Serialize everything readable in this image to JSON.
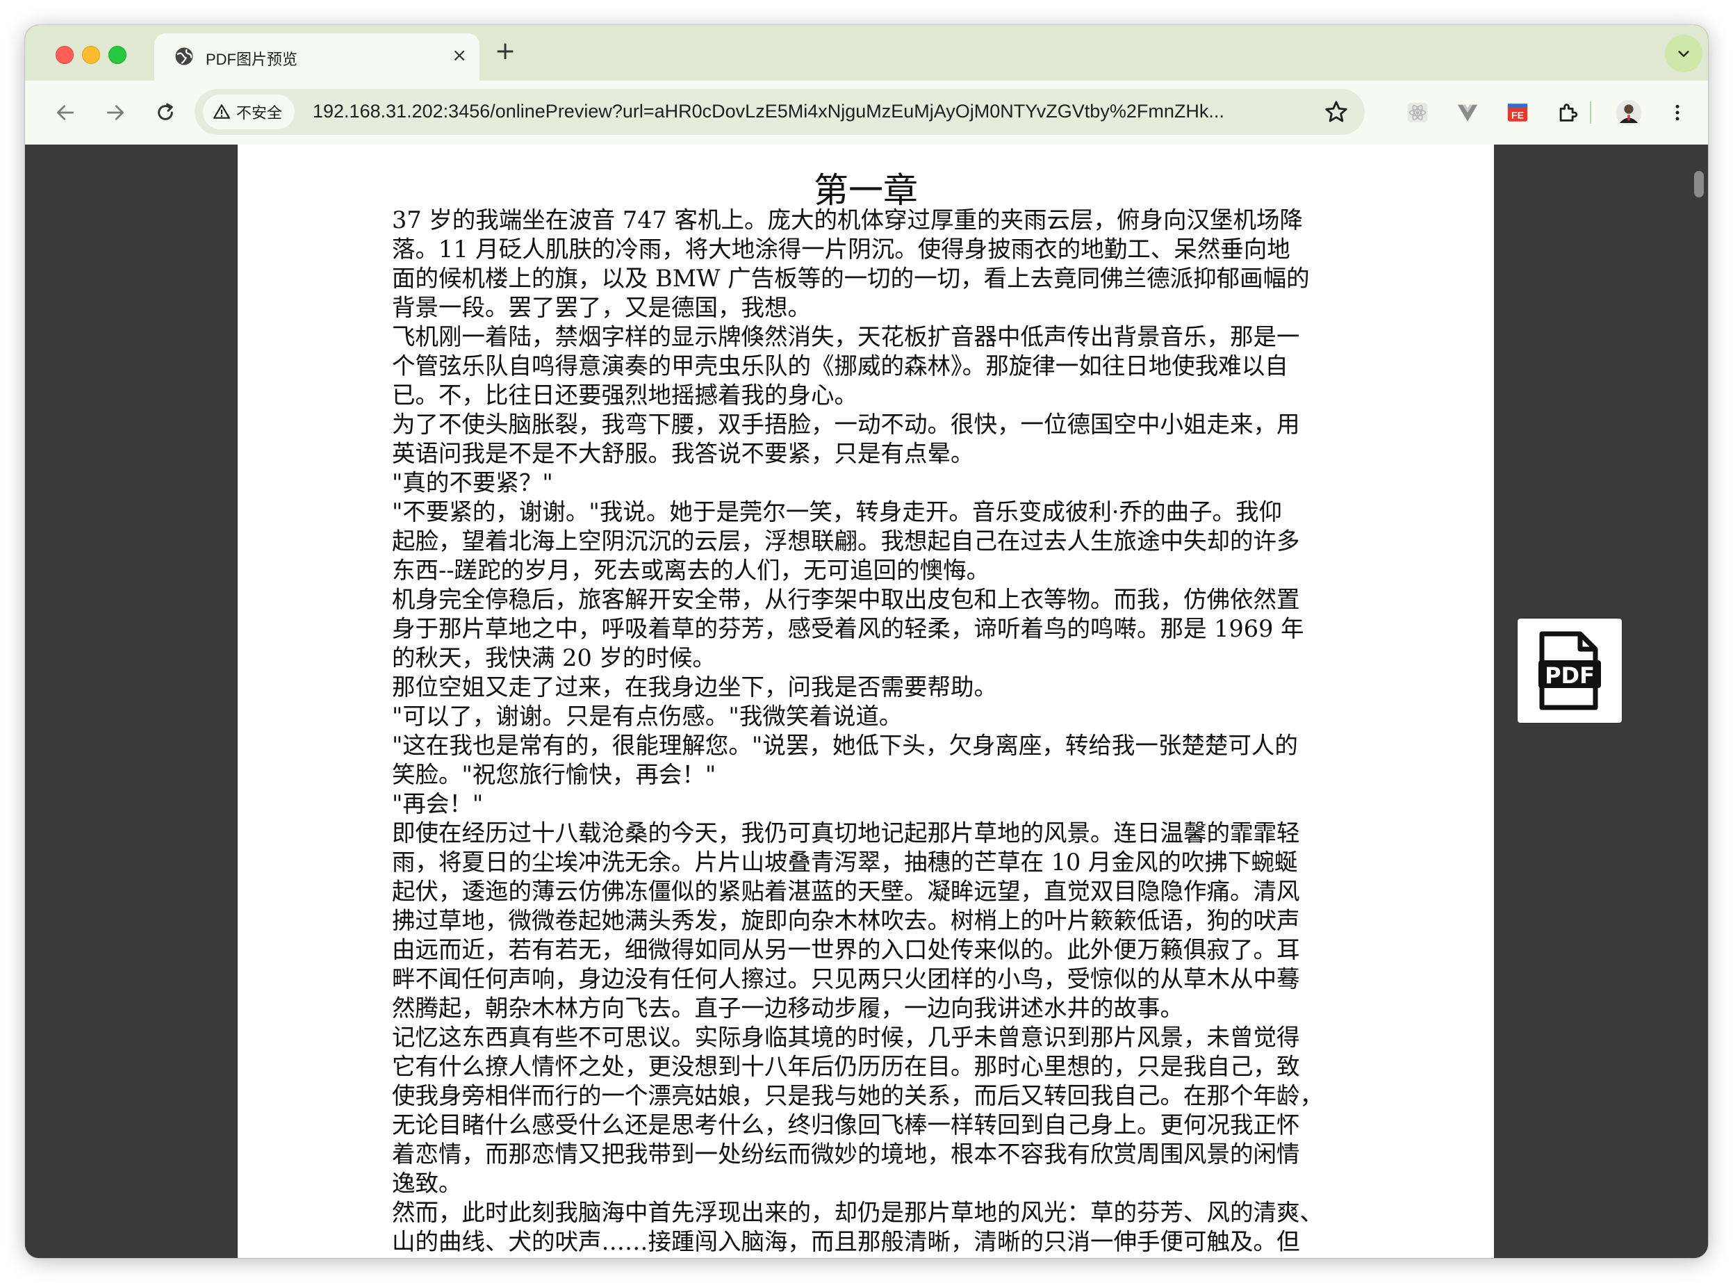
{
  "browser": {
    "tab": {
      "title": "PDF图片预览",
      "close_label": "×",
      "favicon": "globe-icon"
    },
    "new_tab_label": "+",
    "security_label": "不安全",
    "url": "192.168.31.202:3456/onlinePreview?url=aHR0cDovLzE5Mi4xNjguMzEuMjAyOjM0NTYvZGVtby%2FmnZHk...",
    "extensions": [
      "react-devtools-icon",
      "vue-devtools-icon",
      "fehelper-icon",
      "puzzle-icon"
    ],
    "fehelper_label": "FE"
  },
  "document": {
    "chapter_title": "第一章",
    "lines": [
      "37 岁的我端坐在波音 747 客机上。庞大的机体穿过厚重的夹雨云层，俯身向汉堡机场降",
      "落。11 月砭人肌肤的冷雨，将大地涂得一片阴沉。使得身披雨衣的地勤工、呆然垂向地",
      "面的候机楼上的旗，以及 BMW 广告板等的一切的一切，看上去竟同佛兰德派抑郁画幅的",
      "背景一段。罢了罢了，又是德国，我想。",
      "飞机刚一着陆，禁烟字样的显示牌倏然消失，天花板扩音器中低声传出背景音乐，那是一",
      "个管弦乐队自鸣得意演奏的甲壳虫乐队的《挪威的森林》。那旋律一如往日地使我难以自",
      "已。不，比往日还要强烈地摇撼着我的身心。",
      "为了不使头脑胀裂，我弯下腰，双手捂脸，一动不动。很快，一位德国空中小姐走来，用",
      "英语问我是不是不大舒服。我答说不要紧，只是有点晕。",
      "\"真的不要紧？\"",
      "\"不要紧的，谢谢。\"我说。她于是莞尔一笑，转身走开。音乐变成彼利·乔的曲子。我仰",
      "起脸，望着北海上空阴沉沉的云层，浮想联翩。我想起自己在过去人生旅途中失却的许多",
      "东西--蹉跎的岁月，死去或离去的人们，无可追回的懊悔。",
      "机身完全停稳后，旅客解开安全带，从行李架中取出皮包和上衣等物。而我，仿佛依然置",
      "身于那片草地之中，呼吸着草的芬芳，感受着风的轻柔，谛听着鸟的鸣啭。那是 1969 年",
      "的秋天，我快满 20 岁的时候。",
      "那位空姐又走了过来，在我身边坐下，问我是否需要帮助。",
      "\"可以了，谢谢。只是有点伤感。\"我微笑着说道。",
      "\"这在我也是常有的，很能理解您。\"说罢，她低下头，欠身离座，转给我一张楚楚可人的",
      "笑脸。\"祝您旅行愉快，再会！\"",
      "\"再会！\"",
      "即使在经历过十八载沧桑的今天，我仍可真切地记起那片草地的风景。连日温馨的霏霏轻",
      "雨，将夏日的尘埃冲洗无余。片片山坡叠青泻翠，抽穗的芒草在 10 月金风的吹拂下蜿蜒",
      "起伏，逶迤的薄云仿佛冻僵似的紧贴着湛蓝的天壁。凝眸远望，直觉双目隐隐作痛。清风",
      "拂过草地，微微卷起她满头秀发，旋即向杂木林吹去。树梢上的叶片簌簌低语，狗的吠声",
      "由远而近，若有若无，细微得如同从另一世界的入口处传来似的。此外便万籁俱寂了。耳",
      "畔不闻任何声响，身边没有任何人擦过。只见两只火团样的小鸟，受惊似的从草木从中蓦",
      "然腾起，朝杂木林方向飞去。直子一边移动步履，一边向我讲述水井的故事。",
      "记忆这东西真有些不可思议。实际身临其境的时候，几乎未曾意识到那片风景，未曾觉得",
      "它有什么撩人情怀之处，更没想到十八年后仍历历在目。那时心里想的，只是我自己，致",
      "使我身旁相伴而行的一个漂亮姑娘，只是我与她的关系，而后又转回我自己。在那个年龄，",
      "无论目睹什么感受什么还是思考什么，终归像回飞棒一样转回到自己身上。更何况我正怀",
      "着恋情，而那恋情又把我带到一处纷纭而微妙的境地，根本不容我有欣赏周围风景的闲情",
      "逸致。",
      "然而，此时此刻我脑海中首先浮现出来的，却仍是那片草地的风光：草的芬芳、风的清爽、",
      "山的曲线、犬的吠声……接踵闯入脑海，而且那般清晰，清晰的只消一伸手便可触及。但"
    ]
  },
  "pdf_button": {
    "label": "PDF",
    "icon": "pdf-file-icon"
  }
}
